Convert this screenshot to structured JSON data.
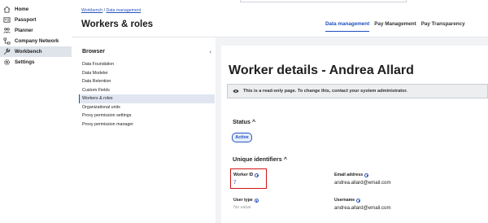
{
  "nav": {
    "items": [
      {
        "label": "Home",
        "icon": "home-icon"
      },
      {
        "label": "Passport",
        "icon": "id-card-icon"
      },
      {
        "label": "Planner",
        "icon": "people-icon"
      },
      {
        "label": "Company Network",
        "icon": "network-icon"
      },
      {
        "label": "Workbench",
        "icon": "wrench-icon"
      },
      {
        "label": "Settings",
        "icon": "gear-icon"
      }
    ],
    "active_index": 4
  },
  "header": {
    "breadcrumb": {
      "first": "Workbench",
      "separator": " / ",
      "second": "Data management"
    },
    "title": "Workers & roles",
    "tabs": [
      {
        "label": "Data management",
        "active": true
      },
      {
        "label": "Pay Management",
        "active": false
      },
      {
        "label": "Pay Transparency",
        "active": false
      }
    ]
  },
  "browser": {
    "title": "Browser",
    "items": [
      "Data Foundation",
      "Data Modeler",
      "Data Retention",
      "Custom Fields",
      "Workers & roles",
      "Organizational units",
      "Proxy permission settings",
      "Proxy permission manager"
    ],
    "active_index": 4
  },
  "details": {
    "title": "Worker details - Andrea Allard",
    "banner": "This is a read-only page. To change this, contact your system administrator.",
    "status_title": "Status ^",
    "status_value": "Active",
    "identifiers_title": "Unique identifiers ^",
    "fields": {
      "worker_id_label": "Worker ID",
      "worker_id_value": "7",
      "email_label": "Email address",
      "email_value": "andrea.allard@email.com",
      "user_type_label": "User type",
      "user_type_value": "No value",
      "username_label": "Username",
      "username_value": "andrea.allard@email.com"
    }
  },
  "colors": {
    "accent": "#1f4fbf",
    "highlight": "#d11414",
    "active_nav_bg": "#dfe3ea"
  }
}
